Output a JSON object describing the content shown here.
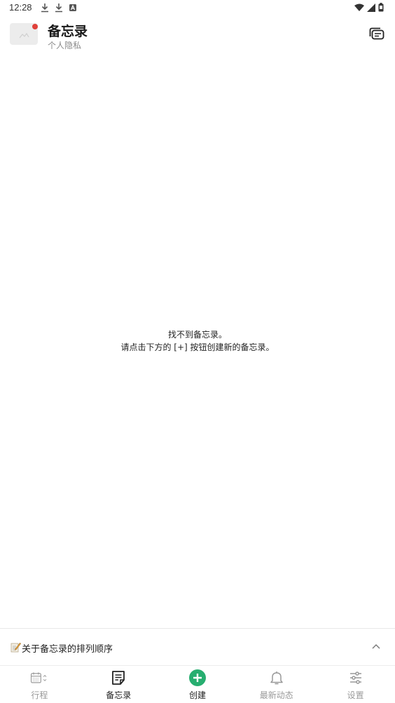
{
  "status_bar": {
    "time": "12:28"
  },
  "header": {
    "title": "备忘录",
    "subtitle": "个人隐私"
  },
  "empty_state": {
    "line1": "找不到备忘录。",
    "line2": "请点击下方的 [+] 按钮创建新的备忘录。"
  },
  "sort_bar": {
    "label": "关于备忘录的排列顺序"
  },
  "bottom_nav": {
    "items": [
      {
        "label": "行程",
        "icon": "calendar-icon"
      },
      {
        "label": "备忘录",
        "icon": "memo-icon"
      },
      {
        "label": "创建",
        "icon": "plus-circle-icon"
      },
      {
        "label": "最新动态",
        "icon": "bell-icon"
      },
      {
        "label": "设置",
        "icon": "sliders-icon"
      }
    ]
  },
  "colors": {
    "accent": "#27ae70",
    "notification_dot": "#e0403a"
  }
}
